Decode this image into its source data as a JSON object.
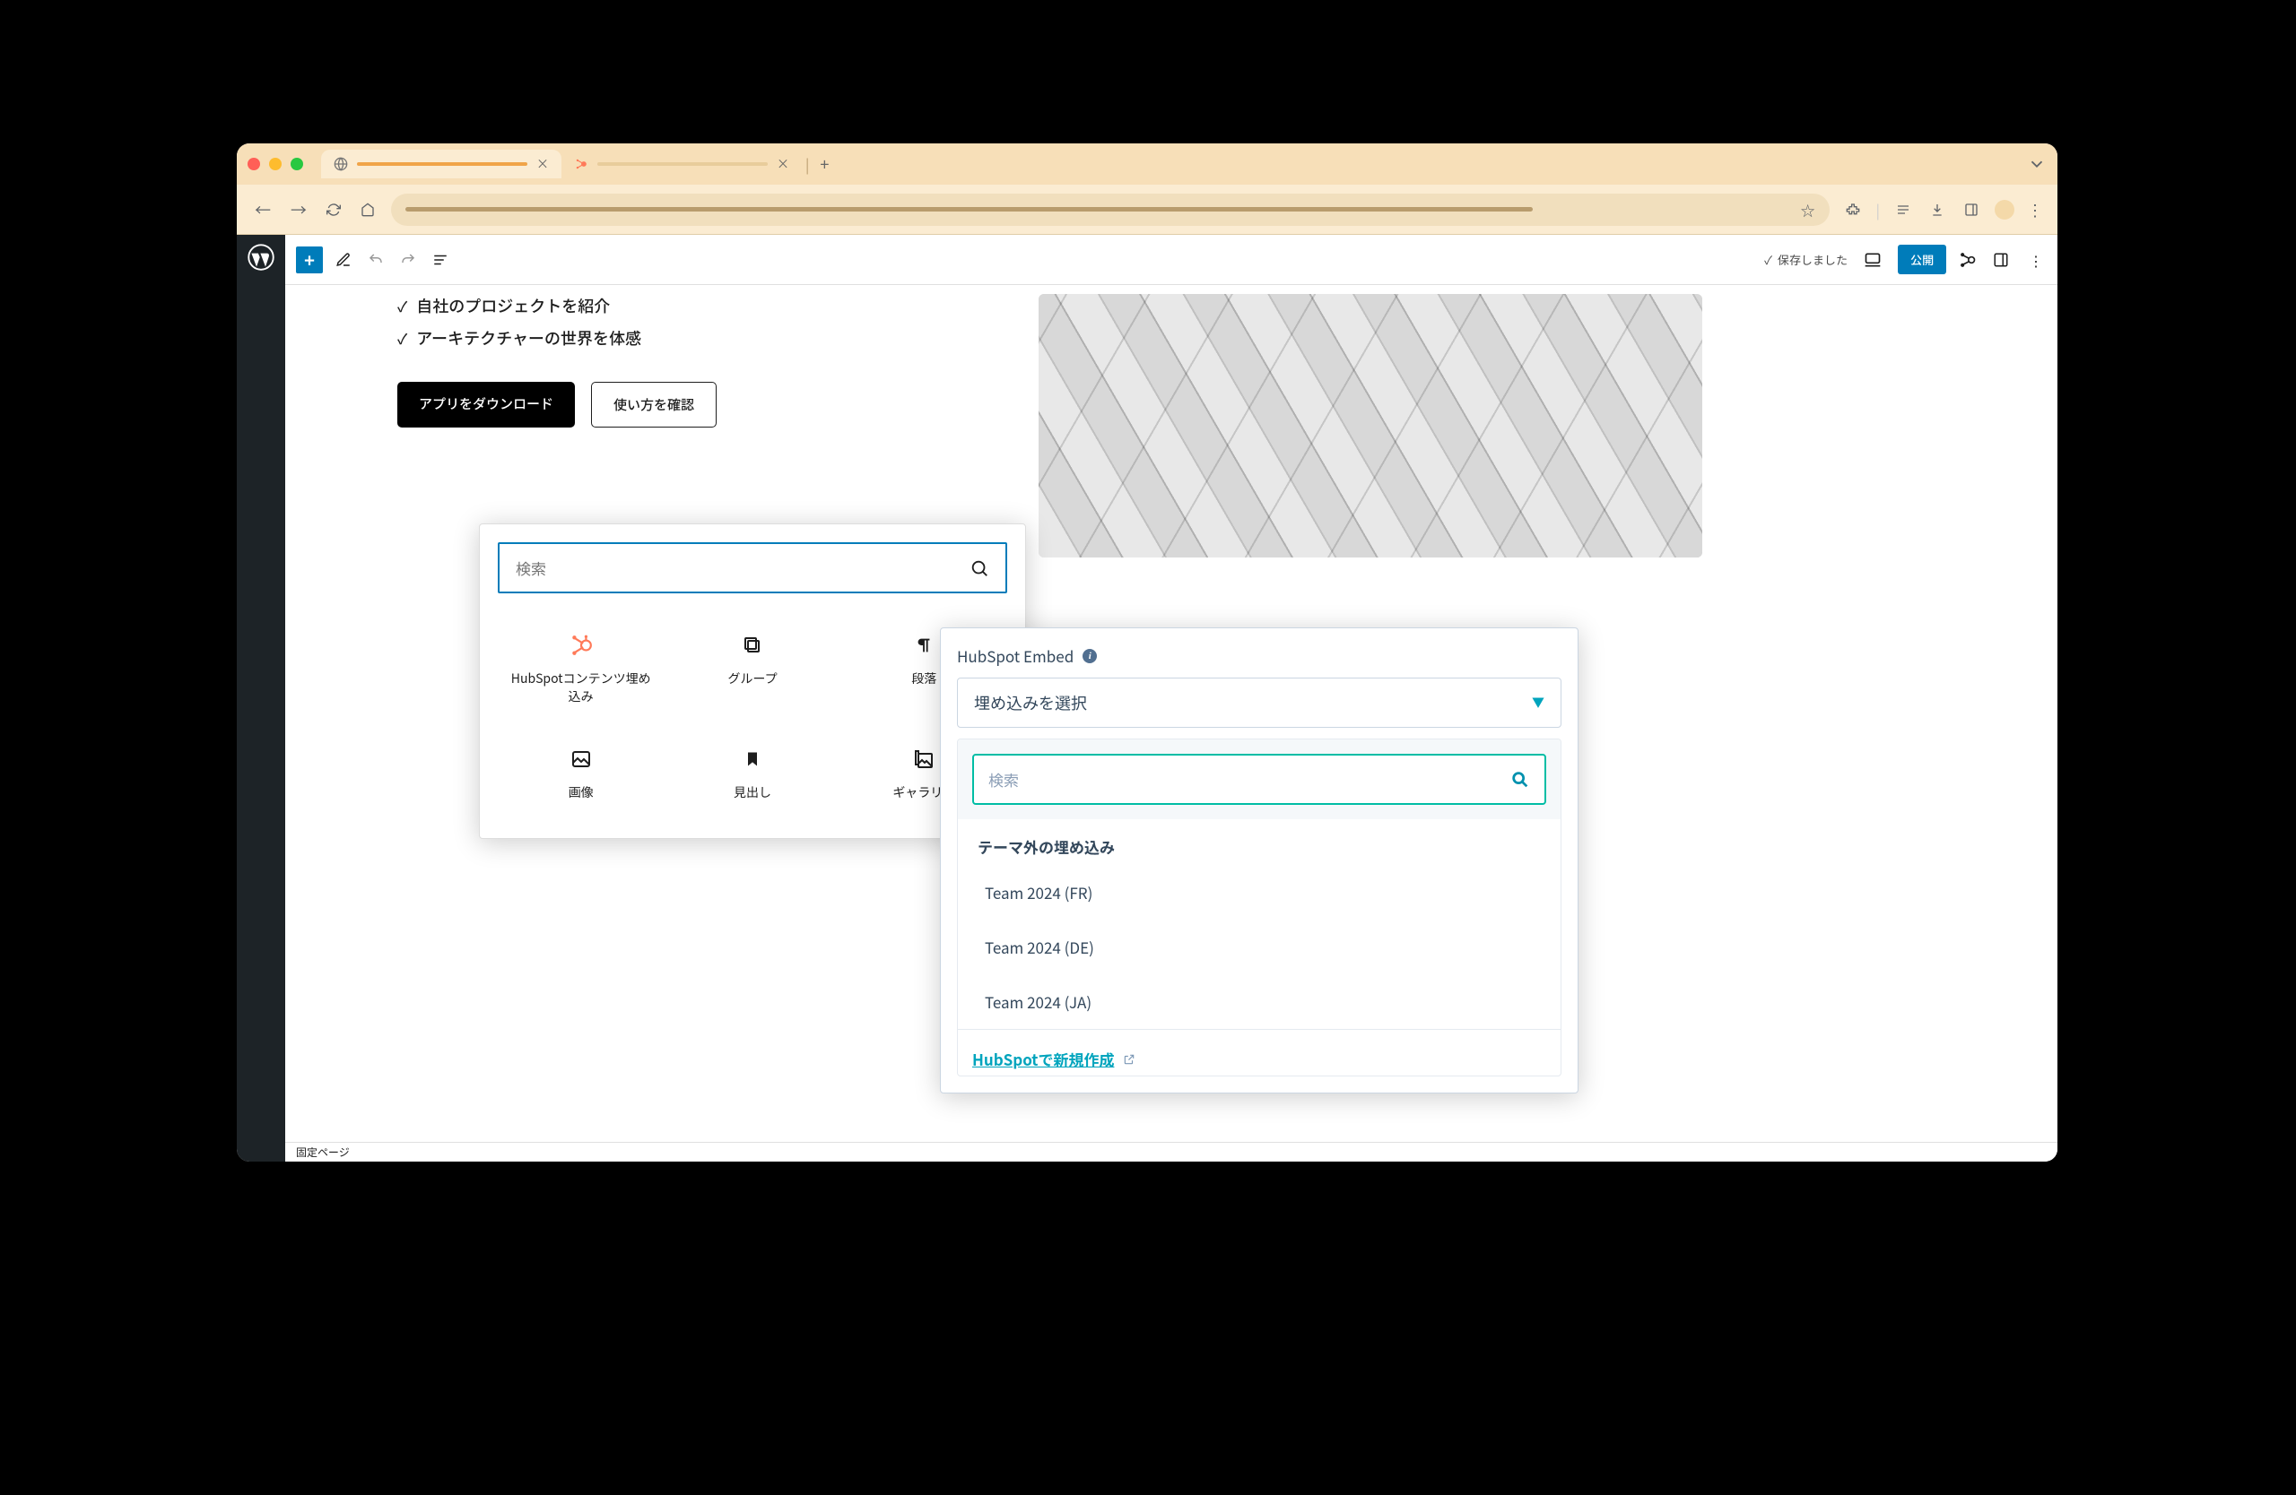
{
  "browser": {
    "tabs": [
      "",
      ""
    ],
    "new_tab": "+"
  },
  "wp": {
    "saved_text": "保存しました",
    "publish_label": "公開",
    "footer_text": "固定ページ"
  },
  "content": {
    "checks": [
      "自社のプロジェクトを紹介",
      "アーキテクチャーの世界を体感"
    ],
    "btn_download": "アプリをダウンロード",
    "btn_howto": "使い方を確認"
  },
  "inserter": {
    "search_placeholder": "検索",
    "blocks": [
      {
        "label": "HubSpotコンテンツ埋め込み",
        "icon": "hubspot"
      },
      {
        "label": "グループ",
        "icon": "group"
      },
      {
        "label": "段落",
        "icon": "paragraph"
      },
      {
        "label": "画像",
        "icon": "image"
      },
      {
        "label": "見出し",
        "icon": "heading"
      },
      {
        "label": "ギャラリー",
        "icon": "gallery"
      }
    ]
  },
  "hubspot": {
    "title": "HubSpot Embed",
    "select_label": "埋め込みを選択",
    "search_placeholder": "検索",
    "section_title": "テーマ外の埋め込み",
    "options": [
      "Team 2024 (FR)",
      "Team 2024 (DE)",
      "Team 2024 (JA)"
    ],
    "create_link": "HubSpotで新規作成"
  }
}
